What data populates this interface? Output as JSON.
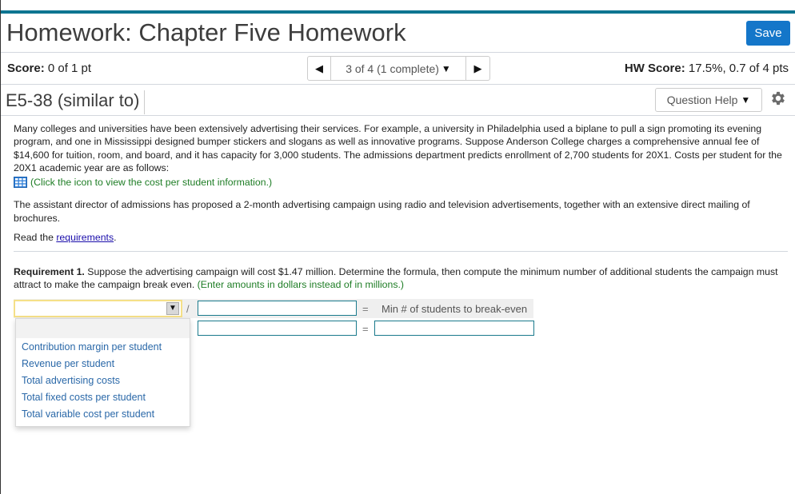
{
  "header": {
    "title": "Homework: Chapter Five Homework",
    "save_label": "Save"
  },
  "score_bar": {
    "score_label": "Score:",
    "score_value": "0 of 1 pt",
    "pager": {
      "prev_icon": "triangle-left-icon",
      "position_label": "3 of 4 (1 complete)",
      "next_icon": "triangle-right-icon"
    },
    "hw_score_label": "HW Score:",
    "hw_score_value": "17.5%, 0.7 of 4 pts"
  },
  "question_bar": {
    "question_id": "E5-38 (similar to)",
    "help_label": "Question Help",
    "settings_icon": "gear-icon"
  },
  "problem": {
    "intro": "Many colleges and universities have been extensively advertising their services. For example, a university in Philadelphia used a biplane to pull a sign promoting its evening program, and one in Mississippi designed bumper stickers and slogans as well as innovative programs. Suppose Anderson College charges a comprehensive annual fee of $14,600 for tuition, room, and board, and it has capacity for 3,000 students. The admissions department predicts enrollment of 2,700 students for 20X1. Costs per student for the 20X1 academic year are as follows:",
    "table_link": "(Click the icon to view the cost per student information.)",
    "campaign": "The assistant director of admissions has proposed a 2-month advertising campaign using radio and television advertisements, together with an extensive direct mailing of brochures.",
    "read_prefix": "Read the ",
    "read_link": "requirements",
    "read_suffix": "."
  },
  "requirement": {
    "label": "Requirement 1.",
    "text": " Suppose the advertising campaign will cost $1.47 million. Determine the formula, then compute the minimum number of additional students the campaign must attract to make the campaign break even. ",
    "note": "(Enter amounts in dollars instead of in millions.)"
  },
  "formula": {
    "selected_value": "",
    "divider": "/",
    "equals": "=",
    "result_label": "Min # of students to break-even",
    "input_values": {
      "denominator": "",
      "row2_numerator": "",
      "row2_denominator": "",
      "row2_result": ""
    }
  },
  "dropdown": {
    "options": [
      "",
      "Contribution margin per student",
      "Revenue per student",
      "Total advertising costs",
      "Total fixed costs per student",
      "Total variable cost per student"
    ]
  },
  "colors": {
    "accent_bar": "#0d7591",
    "save_button": "#1476c9",
    "hint_green": "#1e7d25",
    "option_blue": "#2a68a8",
    "input_border": "#1a7a8c",
    "select_focus": "#f5e088"
  }
}
